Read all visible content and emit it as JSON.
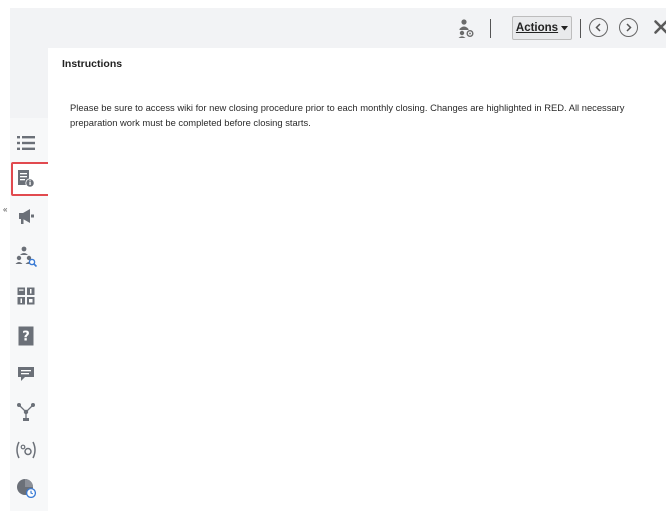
{
  "toolbar": {
    "actions_label": "Actions",
    "icons": [
      "people-settings-icon",
      "previous-circle-icon",
      "next-circle-icon",
      "close-icon"
    ]
  },
  "sidebar": {
    "items": [
      {
        "name": "list-icon"
      },
      {
        "name": "document-info-icon",
        "selected": true
      },
      {
        "name": "megaphone-icon"
      },
      {
        "name": "people-search-icon"
      },
      {
        "name": "dashboard-tiles-icon"
      },
      {
        "name": "question-document-icon"
      },
      {
        "name": "comment-icon"
      },
      {
        "name": "workflow-icon"
      },
      {
        "name": "variables-icon"
      },
      {
        "name": "chart-clock-icon"
      }
    ],
    "collapse_glyph": "«"
  },
  "main": {
    "title": "Instructions",
    "body": "Please be sure to access wiki for new closing procedure prior to each monthly closing. Changes are highlighted in RED. All necessary preparation work must be completed before closing starts."
  },
  "colors": {
    "highlight": "#e14a4f",
    "toolbar_bg": "#f2f3f5"
  }
}
